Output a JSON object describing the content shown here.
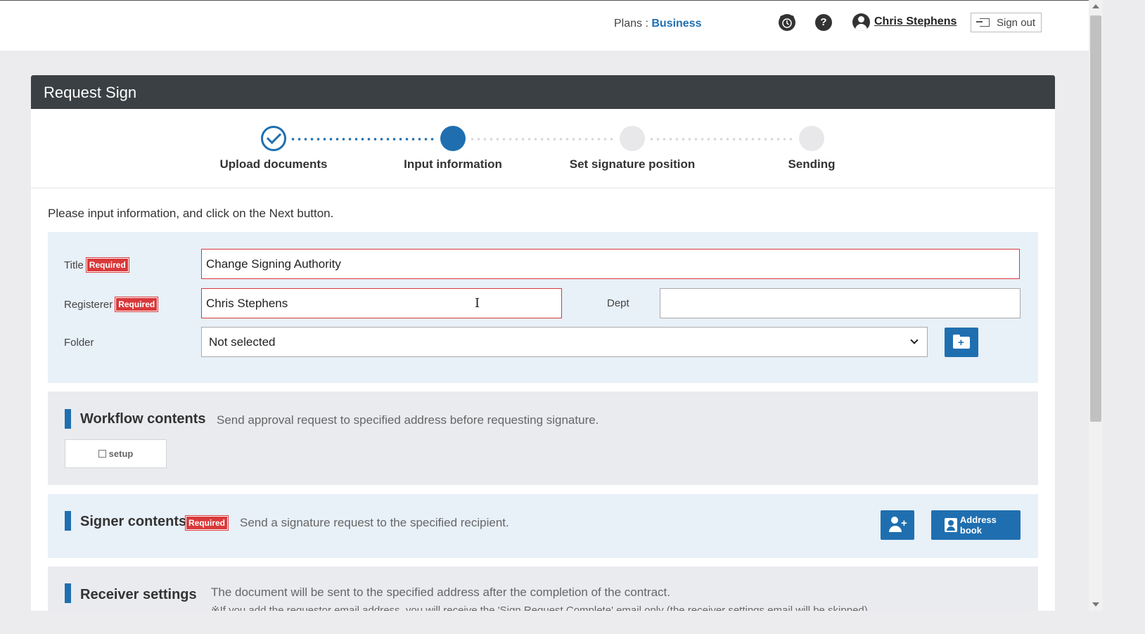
{
  "header": {
    "plans_label": "Plans : ",
    "plan_value": "Business",
    "alarm_icon": "alarm-clock-icon",
    "help_glyph": "?",
    "user_name": "Chris Stephens",
    "sign_out_label": "Sign out"
  },
  "card": {
    "title": "Request Sign"
  },
  "steps": [
    {
      "label": "Upload documents",
      "state": "done"
    },
    {
      "label": "Input information",
      "state": "active"
    },
    {
      "label": "Set signature position",
      "state": "todo"
    },
    {
      "label": "Sending",
      "state": "todo"
    }
  ],
  "instruction": "Please input information, and click on the Next button.",
  "form": {
    "required_badge": "Required",
    "title_label": "Title",
    "title_value": "Change Signing Authority",
    "registerer_label": "Registerer",
    "registerer_value": "Chris Stephens",
    "dept_label": "Dept",
    "dept_value": "",
    "folder_label": "Folder",
    "folder_value": "Not selected"
  },
  "workflow": {
    "title": "Workflow contents",
    "description": "Send approval request to specified address before requesting signature.",
    "setup_label": "setup"
  },
  "signer": {
    "title": "Signer contents",
    "description": "Send a signature request to the specified recipient.",
    "address_book_label": "Address book"
  },
  "receiver": {
    "title": "Receiver settings",
    "description": "The document will be sent to the specified address after the completion of the contract.",
    "note": "※If you add the requestor email address, you will receive the 'Sign Request Complete' email only (the receiver settings email will be skipped)."
  },
  "colors": {
    "accent": "#1f6fb0",
    "header_dark": "#3a4043",
    "required_red": "#d9383a"
  }
}
